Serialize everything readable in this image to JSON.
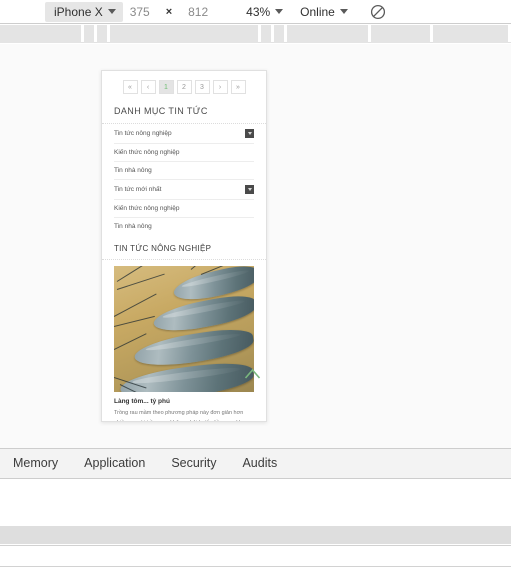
{
  "device_toolbar": {
    "device_name": "iPhone X",
    "width": "375",
    "multiply": "×",
    "height": "812",
    "zoom": "43%",
    "network": "Online",
    "rotate_icon": "rotate-icon",
    "caret_icon": "chevron-down-icon"
  },
  "skeleton": {
    "segments": [
      82,
      10,
      10,
      150,
      10,
      10,
      82,
      60,
      76
    ]
  },
  "page": {
    "pagination": {
      "items": [
        {
          "label": "«",
          "active": false
        },
        {
          "label": "‹",
          "active": false
        },
        {
          "label": "1",
          "active": true
        },
        {
          "label": "2",
          "active": false
        },
        {
          "label": "3",
          "active": false
        },
        {
          "label": "›",
          "active": false
        },
        {
          "label": "»",
          "active": false
        }
      ]
    },
    "category_section": {
      "heading": "DANH MỤC TIN TỨC",
      "items": [
        {
          "label": "Tin tức nông nghiệp",
          "expandable": true
        },
        {
          "label": "Kiến thức nông nghiệp",
          "expandable": false
        },
        {
          "label": "Tin nhà nông",
          "expandable": false
        },
        {
          "label": "Tin tức mới nhất",
          "expandable": true
        },
        {
          "label": "Kiến thức nông nghiệp",
          "expandable": false
        },
        {
          "label": "Tin nhà nông",
          "expandable": false
        }
      ]
    },
    "news_section": {
      "heading": "TIN TỨC NÔNG NGHIỆP",
      "article": {
        "image_alt": "shrimp-photo",
        "title": "Làng tôm... tỷ phú",
        "description": "Trồng rau mầm theo phương pháp này đơn giản hơn nhiều, người trồng rau không phải lo tốn tiền mua khay nhựa, hộp xốp, cây sắt làm kệ..."
      }
    },
    "back_to_top": {
      "icon": "chevron-up-icon",
      "color": "#7ab87e"
    }
  },
  "devtools": {
    "tabs": [
      {
        "label": "Memory",
        "active": false
      },
      {
        "label": "Application",
        "active": false
      },
      {
        "label": "Security",
        "active": false
      },
      {
        "label": "Audits",
        "active": false
      }
    ]
  },
  "colors": {
    "accent_green": "#6fbf73",
    "toolbar_bg": "#ffffff",
    "skeleton_grey": "#e4e4e4",
    "tabbar_bg": "#f3f3f3",
    "pane_grey": "#dedede"
  }
}
